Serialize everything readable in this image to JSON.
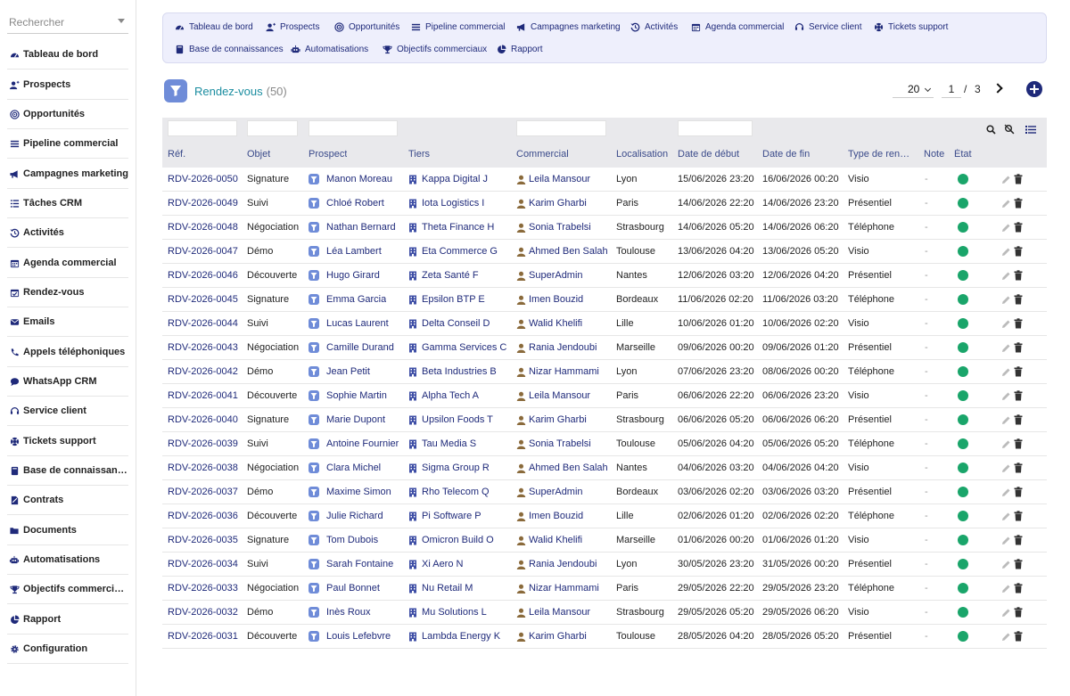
{
  "sidebar": {
    "search_placeholder": "Rechercher",
    "items": [
      {
        "label": "Tableau de bord",
        "icon": "dashboard-icon"
      },
      {
        "label": "Prospects",
        "icon": "user-plus-icon"
      },
      {
        "label": "Opportunités",
        "icon": "target-icon"
      },
      {
        "label": "Pipeline commercial",
        "icon": "bars-icon"
      },
      {
        "label": "Campagnes marketing",
        "icon": "megaphone-icon"
      },
      {
        "label": "Tâches CRM",
        "icon": "task-list-icon"
      },
      {
        "label": "Activités",
        "icon": "history-icon"
      },
      {
        "label": "Agenda commercial",
        "icon": "calendar-icon"
      },
      {
        "label": "Rendez-vous",
        "icon": "calendar-check-icon"
      },
      {
        "label": "Emails",
        "icon": "envelope-icon"
      },
      {
        "label": "Appels téléphoniques",
        "icon": "phone-icon"
      },
      {
        "label": "WhatsApp CRM",
        "icon": "chat-icon"
      },
      {
        "label": "Service client",
        "icon": "headset-icon"
      },
      {
        "label": "Tickets support",
        "icon": "lifebuoy-icon"
      },
      {
        "label": "Base de connaissan…",
        "icon": "book-icon"
      },
      {
        "label": "Contrats",
        "icon": "contract-icon"
      },
      {
        "label": "Documents",
        "icon": "folder-icon"
      },
      {
        "label": "Automatisations",
        "icon": "robot-icon"
      },
      {
        "label": "Objectifs commerciaux",
        "icon": "trophy-icon"
      },
      {
        "label": "Rapport",
        "icon": "pie-chart-icon"
      },
      {
        "label": "Configuration",
        "icon": "gear-icon"
      }
    ]
  },
  "topmenu": {
    "items": [
      {
        "label": "Tableau de bord",
        "icon": "dashboard-icon"
      },
      {
        "label": "Prospects",
        "icon": "user-plus-icon"
      },
      {
        "label": "Opportunités",
        "icon": "target-icon"
      },
      {
        "label": "Pipeline commercial",
        "icon": "bars-icon"
      },
      {
        "label": "Campagnes marketing",
        "icon": "megaphone-icon"
      },
      {
        "label": "Activités",
        "icon": "history-icon"
      },
      {
        "label": "Agenda commercial",
        "icon": "calendar-icon"
      },
      {
        "label": "Service client",
        "icon": "headset-icon"
      },
      {
        "label": "Tickets support",
        "icon": "lifebuoy-icon"
      },
      {
        "label": "Base de connaissances",
        "icon": "book-icon"
      },
      {
        "label": "Automatisations",
        "icon": "robot-icon"
      },
      {
        "label": "Objectifs commerciaux",
        "icon": "trophy-icon"
      },
      {
        "label": "Rapport",
        "icon": "pie-chart-icon"
      }
    ]
  },
  "header": {
    "title": "Rendez-vous",
    "count": "(50)",
    "page_size": "20",
    "page": "1",
    "page_sep": "/",
    "total_pages": "3"
  },
  "table": {
    "columns": [
      "Réf.",
      "Objet",
      "Prospect",
      "Tiers",
      "Commercial",
      "Localisation",
      "Date de début",
      "Date de fin",
      "Type de ren…",
      "Note",
      "État"
    ],
    "state_color": "#1aa56a",
    "rows": [
      {
        "ref": "RDV-2026-0050",
        "obj": "Signature",
        "prospect": "Manon Moreau",
        "tiers": "Kappa Digital J",
        "commercial": "Leila Mansour",
        "loc": "Lyon",
        "start": "15/06/2026 23:20",
        "end": "16/06/2026 00:20",
        "type": "Visio",
        "note": "-"
      },
      {
        "ref": "RDV-2026-0049",
        "obj": "Suivi",
        "prospect": "Chloé Robert",
        "tiers": "Iota Logistics I",
        "commercial": "Karim Gharbi",
        "loc": "Paris",
        "start": "14/06/2026 22:20",
        "end": "14/06/2026 23:20",
        "type": "Présentiel",
        "note": "-"
      },
      {
        "ref": "RDV-2026-0048",
        "obj": "Négociation",
        "prospect": "Nathan Bernard",
        "tiers": "Theta Finance H",
        "commercial": "Sonia Trabelsi",
        "loc": "Strasbourg",
        "start": "14/06/2026 05:20",
        "end": "14/06/2026 06:20",
        "type": "Téléphone",
        "note": "-"
      },
      {
        "ref": "RDV-2026-0047",
        "obj": "Démo",
        "prospect": "Léa Lambert",
        "tiers": "Eta Commerce G",
        "commercial": "Ahmed Ben Salah",
        "loc": "Toulouse",
        "start": "13/06/2026 04:20",
        "end": "13/06/2026 05:20",
        "type": "Visio",
        "note": "-"
      },
      {
        "ref": "RDV-2026-0046",
        "obj": "Découverte",
        "prospect": "Hugo Girard",
        "tiers": "Zeta Santé F",
        "commercial": "SuperAdmin",
        "loc": "Nantes",
        "start": "12/06/2026 03:20",
        "end": "12/06/2026 04:20",
        "type": "Présentiel",
        "note": "-"
      },
      {
        "ref": "RDV-2026-0045",
        "obj": "Signature",
        "prospect": "Emma Garcia",
        "tiers": "Epsilon BTP E",
        "commercial": "Imen Bouzid",
        "loc": "Bordeaux",
        "start": "11/06/2026 02:20",
        "end": "11/06/2026 03:20",
        "type": "Téléphone",
        "note": "-"
      },
      {
        "ref": "RDV-2026-0044",
        "obj": "Suivi",
        "prospect": "Lucas Laurent",
        "tiers": "Delta Conseil D",
        "commercial": "Walid Khelifi",
        "loc": "Lille",
        "start": "10/06/2026 01:20",
        "end": "10/06/2026 02:20",
        "type": "Visio",
        "note": "-"
      },
      {
        "ref": "RDV-2026-0043",
        "obj": "Négociation",
        "prospect": "Camille Durand",
        "tiers": "Gamma Services C",
        "commercial": "Rania Jendoubi",
        "loc": "Marseille",
        "start": "09/06/2026 00:20",
        "end": "09/06/2026 01:20",
        "type": "Présentiel",
        "note": "-"
      },
      {
        "ref": "RDV-2026-0042",
        "obj": "Démo",
        "prospect": "Jean Petit",
        "tiers": "Beta Industries B",
        "commercial": "Nizar Hammami",
        "loc": "Lyon",
        "start": "07/06/2026 23:20",
        "end": "08/06/2026 00:20",
        "type": "Téléphone",
        "note": "-"
      },
      {
        "ref": "RDV-2026-0041",
        "obj": "Découverte",
        "prospect": "Sophie Martin",
        "tiers": "Alpha Tech A",
        "commercial": "Leila Mansour",
        "loc": "Paris",
        "start": "06/06/2026 22:20",
        "end": "06/06/2026 23:20",
        "type": "Visio",
        "note": "-"
      },
      {
        "ref": "RDV-2026-0040",
        "obj": "Signature",
        "prospect": "Marie Dupont",
        "tiers": "Upsilon Foods T",
        "commercial": "Karim Gharbi",
        "loc": "Strasbourg",
        "start": "06/06/2026 05:20",
        "end": "06/06/2026 06:20",
        "type": "Présentiel",
        "note": "-"
      },
      {
        "ref": "RDV-2026-0039",
        "obj": "Suivi",
        "prospect": "Antoine Fournier",
        "tiers": "Tau Media S",
        "commercial": "Sonia Trabelsi",
        "loc": "Toulouse",
        "start": "05/06/2026 04:20",
        "end": "05/06/2026 05:20",
        "type": "Téléphone",
        "note": "-"
      },
      {
        "ref": "RDV-2026-0038",
        "obj": "Négociation",
        "prospect": "Clara Michel",
        "tiers": "Sigma Group R",
        "commercial": "Ahmed Ben Salah",
        "loc": "Nantes",
        "start": "04/06/2026 03:20",
        "end": "04/06/2026 04:20",
        "type": "Visio",
        "note": "-"
      },
      {
        "ref": "RDV-2026-0037",
        "obj": "Démo",
        "prospect": "Maxime Simon",
        "tiers": "Rho Telecom Q",
        "commercial": "SuperAdmin",
        "loc": "Bordeaux",
        "start": "03/06/2026 02:20",
        "end": "03/06/2026 03:20",
        "type": "Présentiel",
        "note": "-"
      },
      {
        "ref": "RDV-2026-0036",
        "obj": "Découverte",
        "prospect": "Julie Richard",
        "tiers": "Pi Software P",
        "commercial": "Imen Bouzid",
        "loc": "Lille",
        "start": "02/06/2026 01:20",
        "end": "02/06/2026 02:20",
        "type": "Téléphone",
        "note": "-"
      },
      {
        "ref": "RDV-2026-0035",
        "obj": "Signature",
        "prospect": "Tom Dubois",
        "tiers": "Omicron Build O",
        "commercial": "Walid Khelifi",
        "loc": "Marseille",
        "start": "01/06/2026 00:20",
        "end": "01/06/2026 01:20",
        "type": "Visio",
        "note": "-"
      },
      {
        "ref": "RDV-2026-0034",
        "obj": "Suivi",
        "prospect": "Sarah Fontaine",
        "tiers": "Xi Aero N",
        "commercial": "Rania Jendoubi",
        "loc": "Lyon",
        "start": "30/05/2026 23:20",
        "end": "31/05/2026 00:20",
        "type": "Présentiel",
        "note": "-"
      },
      {
        "ref": "RDV-2026-0033",
        "obj": "Négociation",
        "prospect": "Paul Bonnet",
        "tiers": "Nu Retail M",
        "commercial": "Nizar Hammami",
        "loc": "Paris",
        "start": "29/05/2026 22:20",
        "end": "29/05/2026 23:20",
        "type": "Téléphone",
        "note": "-"
      },
      {
        "ref": "RDV-2026-0032",
        "obj": "Démo",
        "prospect": "Inès Roux",
        "tiers": "Mu Solutions L",
        "commercial": "Leila Mansour",
        "loc": "Strasbourg",
        "start": "29/05/2026 05:20",
        "end": "29/05/2026 06:20",
        "type": "Visio",
        "note": "-"
      },
      {
        "ref": "RDV-2026-0031",
        "obj": "Découverte",
        "prospect": "Louis Lefebvre",
        "tiers": "Lambda Energy K",
        "commercial": "Karim Gharbi",
        "loc": "Toulouse",
        "start": "28/05/2026 04:20",
        "end": "28/05/2026 05:20",
        "type": "Présentiel",
        "note": "-"
      }
    ]
  }
}
